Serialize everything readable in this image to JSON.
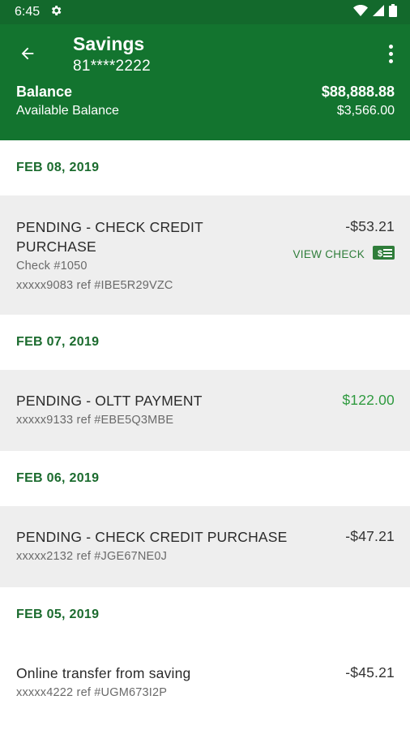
{
  "status_bar": {
    "time": "6:45"
  },
  "header": {
    "title": "Savings",
    "account_number": "81****2222",
    "balance_label": "Balance",
    "balance_value": "$88,888.88",
    "available_label": "Available Balance",
    "available_value": "$3,566.00"
  },
  "groups": [
    {
      "date": "FEB 08, 2019",
      "transactions": [
        {
          "description_line1": "PENDING - CHECK CREDIT",
          "description_line2": "PURCHASE",
          "check": "Check #1050",
          "ref": "xxxxx9083 ref #IBE5R29VZC",
          "amount": "-$53.21",
          "view_check_label": "VIEW CHECK"
        }
      ]
    },
    {
      "date": "FEB 07, 2019",
      "transactions": [
        {
          "description": "PENDING - OLTT PAYMENT",
          "ref": "xxxxx9133 ref #EBE5Q3MBE",
          "amount": "$122.00"
        }
      ]
    },
    {
      "date": "FEB 06, 2019",
      "transactions": [
        {
          "description": "PENDING - CHECK CREDIT PURCHASE",
          "ref": "xxxxx2132 ref #JGE67NE0J",
          "amount": "-$47.21"
        }
      ]
    },
    {
      "date": "FEB 05, 2019",
      "transactions": [
        {
          "description": "Online transfer from saving",
          "ref": "xxxxx4222 ref #UGM673I2P",
          "amount": "-$45.21"
        }
      ]
    }
  ],
  "colors": {
    "header_green": "#13742f",
    "status_green": "#13692c",
    "date_green": "#1b6b2e",
    "positive_amount": "#2f9a3f"
  },
  "icons": [
    "settings-gear-icon",
    "wifi-icon",
    "signal-icon",
    "battery-icon",
    "back-arrow-icon",
    "more-vert-icon",
    "check-image-icon"
  ]
}
